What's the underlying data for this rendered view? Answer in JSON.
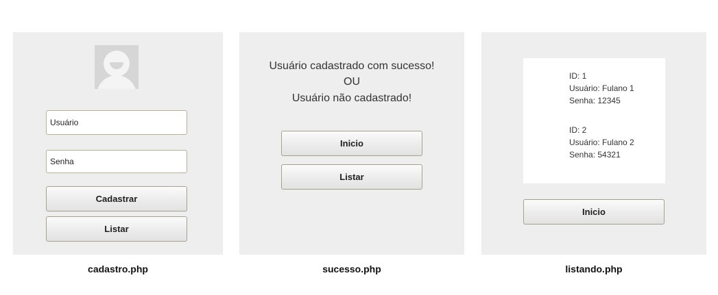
{
  "cadastro": {
    "username_placeholder": "Usuário",
    "password_placeholder": "Senha",
    "register_button": "Cadastrar",
    "list_button": "Listar",
    "caption": "cadastro.php"
  },
  "sucesso": {
    "message_success": "Usuário cadastrado com sucesso!",
    "message_or": "OU",
    "message_failure": "Usuário não cadastrado!",
    "home_button": "Inicio",
    "list_button": "Listar",
    "caption": "sucesso.php"
  },
  "listando": {
    "users": [
      {
        "id": "ID: 1",
        "user": "Usuário: Fulano 1",
        "password": "Senha: 12345"
      },
      {
        "id": "ID: 2",
        "user": "Usuário: Fulano 2",
        "password": "Senha: 54321"
      }
    ],
    "home_button": "Inicio",
    "caption": "listando.php"
  },
  "icons": {
    "avatar": "user-avatar-icon"
  },
  "colors": {
    "panel_bg": "#eeeeee",
    "button_border": "#a99f90"
  }
}
